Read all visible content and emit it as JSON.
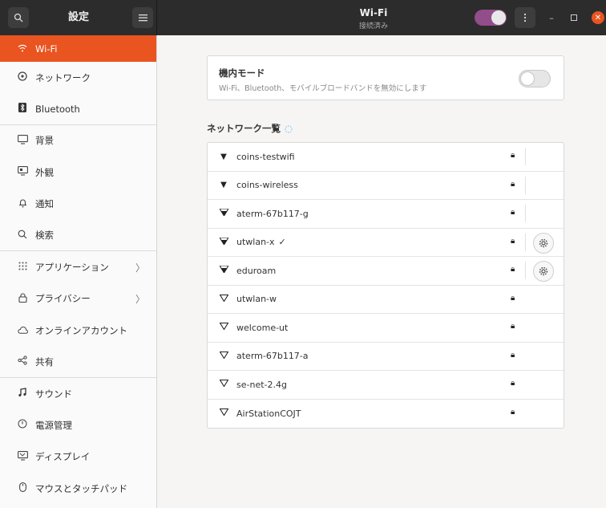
{
  "header": {
    "settings_title": "設定",
    "window_title": "Wi-Fi",
    "window_subtitle": "接続済み",
    "wifi_enabled": true,
    "accent_color": "#924d8b",
    "search_icon": "search-icon",
    "menu_icon": "hamburger-menu-icon"
  },
  "sidebar": {
    "active_color": "#e95420",
    "items": [
      {
        "label": "Wi-Fi",
        "icon": "wifi-icon"
      },
      {
        "label": "ネットワーク",
        "icon": "network-icon"
      },
      {
        "label": "Bluetooth",
        "icon": "bluetooth-icon"
      },
      {
        "label": "背景",
        "icon": "background-icon"
      },
      {
        "label": "外観",
        "icon": "appearance-icon"
      },
      {
        "label": "通知",
        "icon": "bell-icon"
      },
      {
        "label": "検索",
        "icon": "search-icon"
      },
      {
        "label": "アプリケーション",
        "icon": "apps-grid-icon"
      },
      {
        "label": "プライバシー",
        "icon": "lock-icon"
      },
      {
        "label": "オンラインアカウント",
        "icon": "cloud-icon"
      },
      {
        "label": "共有",
        "icon": "share-icon"
      },
      {
        "label": "サウンド",
        "icon": "music-note-icon"
      },
      {
        "label": "電源管理",
        "icon": "power-icon"
      },
      {
        "label": "ディスプレイ",
        "icon": "display-icon"
      },
      {
        "label": "マウスとタッチパッド",
        "icon": "mouse-icon"
      }
    ]
  },
  "airplane_mode": {
    "title": "機内モード",
    "description": "Wi-Fi、Bluetooth、モバイルブロードバンドを無効にします",
    "enabled": false
  },
  "networks": {
    "heading": "ネットワーク一覧",
    "items": [
      {
        "ssid": "coins-testwifi",
        "signal": "full"
      },
      {
        "ssid": "coins-wireless",
        "signal": "full"
      },
      {
        "ssid": "aterm-67b117-g",
        "signal": "strong"
      },
      {
        "ssid": "utwlan-x",
        "signal": "strong",
        "connected_mark": "✓"
      },
      {
        "ssid": "eduroam",
        "signal": "strong"
      },
      {
        "ssid": "utwlan-w",
        "signal": "weak"
      },
      {
        "ssid": "welcome-ut",
        "signal": "weak"
      },
      {
        "ssid": "aterm-67b117-a",
        "signal": "weak"
      },
      {
        "ssid": "se-net-2.4g",
        "signal": "weak"
      },
      {
        "ssid": "AirStationCOJT",
        "signal": "weak"
      }
    ]
  }
}
